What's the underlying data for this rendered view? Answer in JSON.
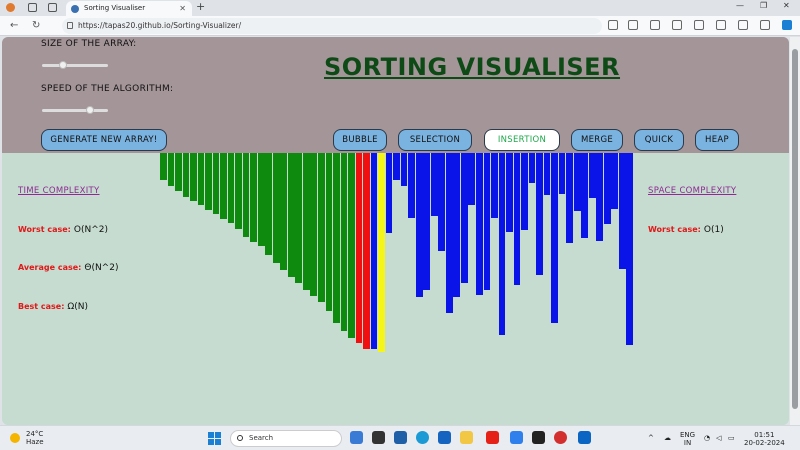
{
  "browser": {
    "tab_title": "Sorting Visualiser",
    "tab_close": "✕",
    "new_tab": "+",
    "url": "https://tapas20.github.io/Sorting-Visualizer/"
  },
  "app": {
    "size_label": "SIZE OF THE ARRAY:",
    "speed_label": "SPEED OF THE ALGORITHM:",
    "size_value": 0.3,
    "speed_value": 0.75,
    "title": "SORTING VISUALISER",
    "generate_button": "GENERATE NEW ARRAY!",
    "algorithms": [
      "BUBBLE",
      "SELECTION",
      "INSERTION",
      "MERGE",
      "QUICK",
      "HEAP"
    ],
    "active_algorithm": "INSERTION",
    "time_complexity": {
      "heading": "TIME COMPLEXITY",
      "worst_label": "Worst case:",
      "worst_value": "O(N^2)",
      "average_label": "Average case:",
      "average_value": "Θ(N^2)",
      "best_label": "Best case:",
      "best_value": "Ω(N)"
    },
    "space_complexity": {
      "heading": "SPACE COMPLEXITY",
      "worst_label": "Worst case:",
      "worst_value": "O(1)"
    }
  },
  "chart_data": {
    "type": "bar",
    "bar_heights": [
      27,
      33,
      38,
      44,
      48,
      52,
      57,
      61,
      66,
      70,
      76,
      84,
      89,
      93,
      102,
      110,
      117,
      124,
      130,
      137,
      143,
      149,
      158,
      170,
      178,
      185,
      190,
      196,
      196,
      199,
      80,
      27,
      33,
      65,
      144,
      137,
      63,
      98,
      160,
      144,
      130,
      52,
      142,
      137,
      65,
      182,
      79,
      132,
      77,
      30,
      122,
      42,
      170,
      41,
      90,
      58,
      85,
      45,
      88,
      71,
      56,
      116,
      192
    ],
    "bar_colors": [
      "green",
      "green",
      "green",
      "green",
      "green",
      "green",
      "green",
      "green",
      "green",
      "green",
      "green",
      "green",
      "green",
      "green",
      "green",
      "green",
      "green",
      "green",
      "green",
      "green",
      "green",
      "green",
      "green",
      "green",
      "green",
      "green",
      "red",
      "red",
      "blue",
      "yellow",
      "blue",
      "blue",
      "blue",
      "blue",
      "blue",
      "blue",
      "blue",
      "blue",
      "blue",
      "blue",
      "blue",
      "blue",
      "blue",
      "blue",
      "blue",
      "blue",
      "blue",
      "blue",
      "blue",
      "blue",
      "blue",
      "blue",
      "blue",
      "blue",
      "blue",
      "blue",
      "blue",
      "blue",
      "blue",
      "blue",
      "blue",
      "blue",
      "blue"
    ],
    "colors": {
      "green": "#0e8a0e",
      "red": "#f01010",
      "yellow": "#f5f51a",
      "blue": "#0a14e8"
    }
  },
  "taskbar": {
    "temp": "24°C",
    "weather": "Haze",
    "search": "Search",
    "lang1": "ENG",
    "lang2": "IN",
    "time": "01:51",
    "date": "20-02-2024"
  }
}
